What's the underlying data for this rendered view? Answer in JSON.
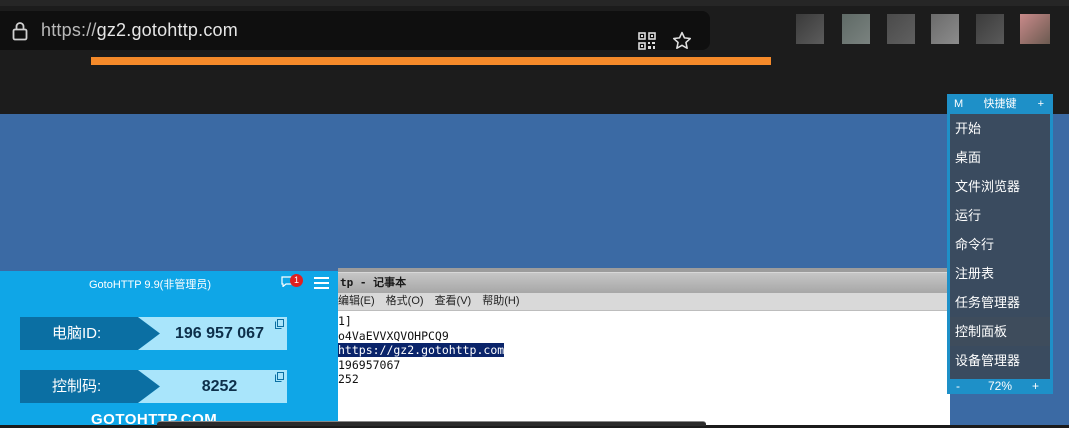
{
  "browser": {
    "url_scheme": "https://",
    "url_host": "gz2.gotohttp.com",
    "load_progress": 1.0,
    "icons": [
      "lock-icon",
      "qr-code-icon",
      "star-icon"
    ],
    "accent_color": "#f58a2a"
  },
  "notepad": {
    "title": "tp - 记事本",
    "menu": [
      "编辑(E)",
      "格式(O)",
      "查看(V)",
      "帮助(H)"
    ],
    "lines": [
      "1]",
      "o4VaEVVXQVOHPCQ9",
      "https://gz2.gotohttp.com",
      "196957067",
      "252"
    ],
    "selected_line": 2
  },
  "gotohttp": {
    "title": "GotoHTTP 9.9(非管理员)",
    "badge_count": "1",
    "computer_id_label": "电脑ID:",
    "computer_id_value": "196 957 067",
    "control_code_label": "控制码:",
    "control_code_value": "8252",
    "brand": "GOTOHTTP.COM"
  },
  "quickkeys": {
    "m_label": "M",
    "title": "快捷键",
    "plus": "+",
    "items": [
      "开始",
      "桌面",
      "文件浏览器",
      "运行",
      "命令行",
      "注册表",
      "任务管理器",
      "控制面板",
      "设备管理器"
    ],
    "zoom_minus": "-",
    "zoom": "72%",
    "zoom_plus": "+"
  }
}
